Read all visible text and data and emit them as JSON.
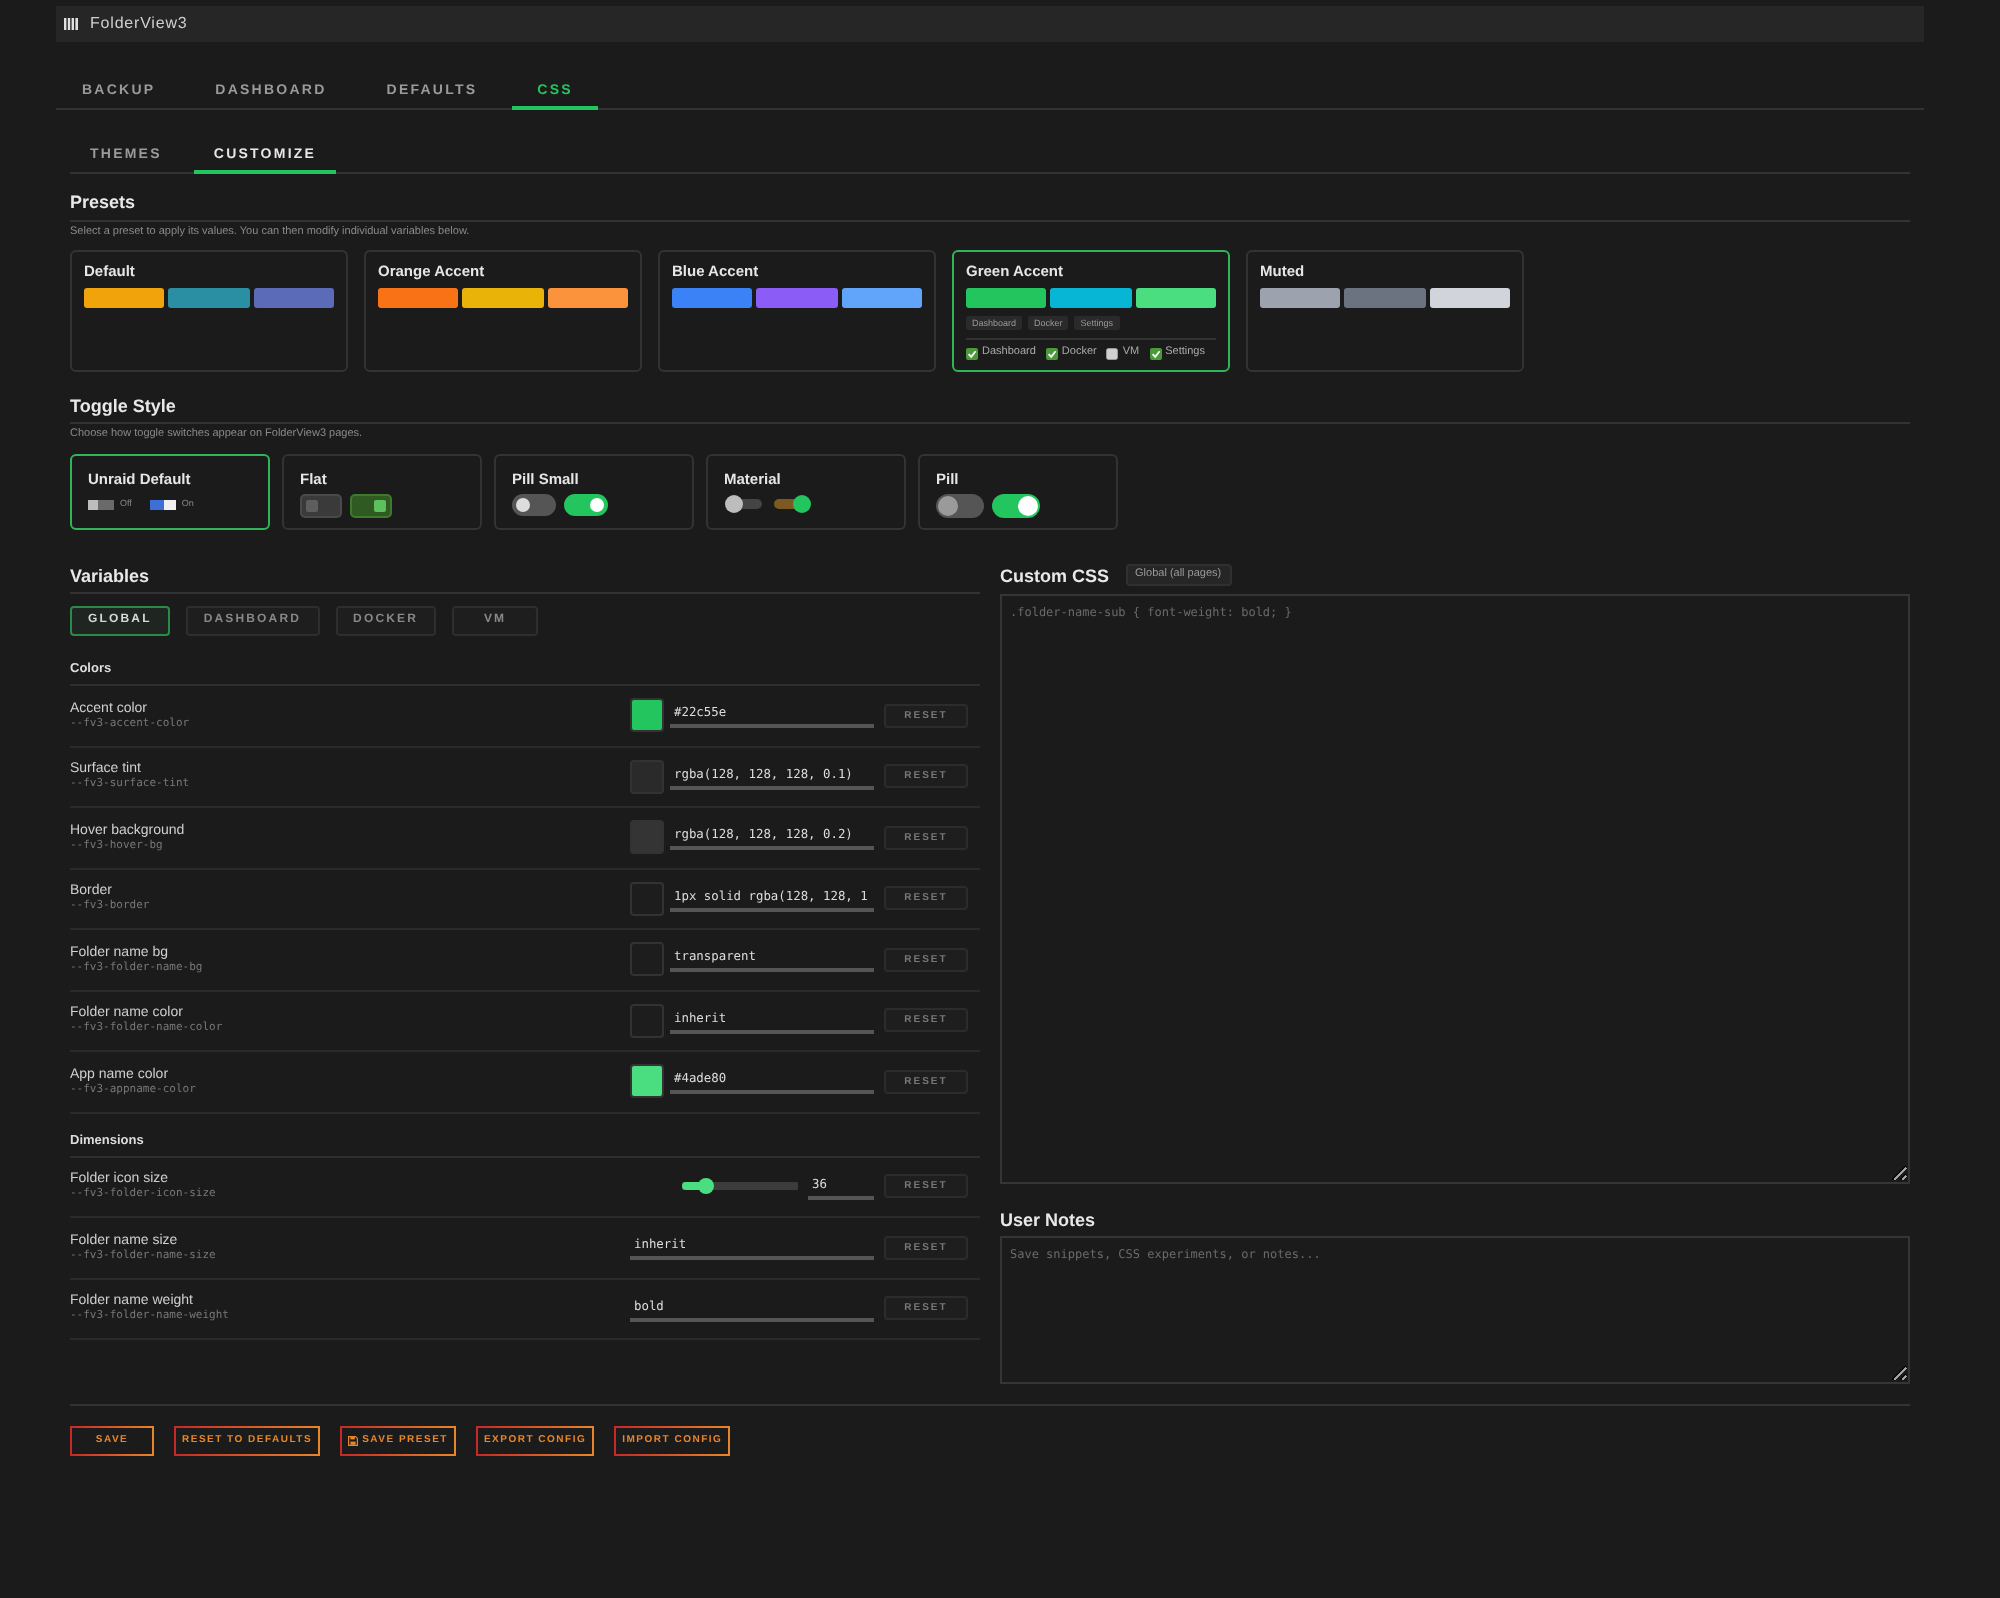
{
  "app": {
    "title": "FolderView3"
  },
  "tabs": [
    {
      "label": "BACKUP",
      "selected": false
    },
    {
      "label": "DASHBOARD",
      "selected": false
    },
    {
      "label": "DEFAULTS",
      "selected": false
    },
    {
      "label": "CSS",
      "selected": true
    }
  ],
  "subtabs": [
    {
      "label": "THEMES",
      "selected": false
    },
    {
      "label": "CUSTOMIZE",
      "selected": true
    }
  ],
  "presets": {
    "title": "Presets",
    "description": "Select a preset to apply its values. You can then modify individual variables below.",
    "items": [
      {
        "name": "Default",
        "selected": false,
        "swatches": [
          {
            "color": "#f0a30a"
          },
          {
            "color": "#2b8fa3"
          },
          {
            "color": "#5c6bb8"
          }
        ]
      },
      {
        "name": "Orange Accent",
        "selected": false,
        "swatches": [
          {
            "color": "#f97316"
          },
          {
            "color": "#eab308"
          },
          {
            "color": "#fb923c"
          }
        ]
      },
      {
        "name": "Blue Accent",
        "selected": false,
        "swatches": [
          {
            "color": "#3b82f6"
          },
          {
            "color": "#8b5cf6"
          },
          {
            "color": "#60a5fa"
          }
        ]
      },
      {
        "name": "Green Accent",
        "selected": true,
        "swatches": [
          {
            "color": "#22c55e"
          },
          {
            "color": "#06b6d4"
          },
          {
            "color": "#4ade80"
          }
        ],
        "tags": [
          "Dashboard",
          "Docker",
          "Settings"
        ],
        "pages": [
          {
            "label": "Dashboard",
            "checked": true
          },
          {
            "label": "Docker",
            "checked": true
          },
          {
            "label": "VM",
            "checked": false
          },
          {
            "label": "Settings",
            "checked": true
          }
        ]
      },
      {
        "name": "Muted",
        "selected": false,
        "swatches": [
          {
            "color": "#9ca3af"
          },
          {
            "color": "#6b7280"
          },
          {
            "color": "#d1d5db"
          }
        ]
      }
    ]
  },
  "toggle_style": {
    "title": "Toggle Style",
    "description": "Choose how toggle switches appear on FolderView3 pages.",
    "items": [
      {
        "name": "Unraid Default",
        "kind": "unraid",
        "selected": true,
        "off_label": "Off",
        "on_label": "On"
      },
      {
        "name": "Flat",
        "kind": "flat",
        "selected": false
      },
      {
        "name": "Pill Small",
        "kind": "pill-small",
        "selected": false
      },
      {
        "name": "Material",
        "kind": "material",
        "selected": false
      },
      {
        "name": "Pill",
        "kind": "pill",
        "selected": false
      }
    ]
  },
  "variables": {
    "title": "Variables",
    "scopes": [
      {
        "label": "GLOBAL",
        "selected": true
      },
      {
        "label": "DASHBOARD",
        "selected": false
      },
      {
        "label": "DOCKER",
        "selected": false
      },
      {
        "label": "VM",
        "selected": false
      }
    ],
    "groups": [
      {
        "title": "Colors",
        "rows": [
          {
            "label": "Accent color",
            "var": "--fv3-accent-color",
            "kind": "color",
            "color": "#22c55e",
            "value": "#22c55e",
            "reset": "RESET"
          },
          {
            "label": "Surface tint",
            "var": "--fv3-surface-tint",
            "kind": "color",
            "color": "#2b2a2b",
            "value": "rgba(128, 128, 128, 0.1)",
            "reset": "RESET"
          },
          {
            "label": "Hover background",
            "var": "--fv3-hover-bg",
            "kind": "color",
            "color": "#353435",
            "value": "rgba(128, 128, 128, 0.2)",
            "reset": "RESET"
          },
          {
            "label": "Border",
            "var": "--fv3-border",
            "kind": "color",
            "color": "#1e1d1e",
            "value": "1px solid rgba(128, 128, 1",
            "reset": "RESET"
          },
          {
            "label": "Folder name bg",
            "var": "--fv3-folder-name-bg",
            "kind": "color",
            "color": "#1e1d1e",
            "value": "transparent",
            "reset": "RESET"
          },
          {
            "label": "Folder name color",
            "var": "--fv3-folder-name-color",
            "kind": "color",
            "color": "#1e1d1e",
            "value": "inherit",
            "reset": "RESET"
          },
          {
            "label": "App name color",
            "var": "--fv3-appname-color",
            "kind": "color",
            "color": "#4ade80",
            "value": "#4ade80",
            "reset": "RESET"
          }
        ]
      },
      {
        "title": "Dimensions",
        "rows": [
          {
            "label": "Folder icon size",
            "var": "--fv3-folder-icon-size",
            "kind": "slider",
            "level": 0.2,
            "value": "36",
            "reset": "RESET"
          },
          {
            "label": "Folder name size",
            "var": "--fv3-folder-name-size",
            "kind": "text",
            "value": "inherit",
            "reset": "RESET"
          },
          {
            "label": "Folder name weight",
            "var": "--fv3-folder-name-weight",
            "kind": "text",
            "value": "bold",
            "reset": "RESET"
          }
        ]
      }
    ]
  },
  "custom_css": {
    "title": "Custom CSS",
    "badge": "Global (all pages)",
    "placeholder": ".folder-name-sub { font-weight: bold; }"
  },
  "user_notes": {
    "title": "User Notes",
    "placeholder": "Save snippets, CSS experiments, or notes..."
  },
  "actions": [
    {
      "label": "SAVE"
    },
    {
      "label": "RESET TO DEFAULTS"
    },
    {
      "label": "SAVE PRESET",
      "icon": true
    },
    {
      "label": "EXPORT CONFIG"
    },
    {
      "label": "IMPORT CONFIG"
    }
  ]
}
